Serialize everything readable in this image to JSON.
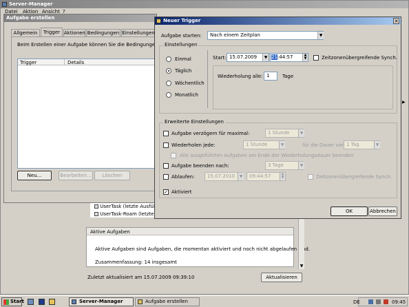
{
  "server_manager": {
    "title": "Server-Manager",
    "menu": [
      "Datei",
      "Aktion",
      "Ansicht",
      "?"
    ],
    "tree_items": [
      "UserTask (letzte Ausführ",
      "UserTask-Roam (letzte Au"
    ],
    "active_tasks_header": "Aktive Aufgaben",
    "active_tasks_desc": "Aktive Aufgaben sind Aufgaben, die momentan aktiviert und noch nicht abgelaufen sind.",
    "summary": "Zusammenfassung: 14 insgesamt",
    "last_updated": "Zuletzt aktualisiert am 15.07.2009 09:39:10",
    "refresh_button": "Aktualisieren"
  },
  "create_task": {
    "title": "Aufgabe erstellen",
    "tabs": [
      "Allgemein",
      "Trigger",
      "Aktionen",
      "Bedingungen",
      "Einstellungen"
    ],
    "active_tab": "Trigger",
    "intro": "Beim Erstellen einer Aufgabe können Sie die Bedingungen ang",
    "columns": [
      "Trigger",
      "Details"
    ],
    "buttons": {
      "new": "Neu...",
      "edit": "Bearbeiten...",
      "delete": "Löschen"
    }
  },
  "new_trigger": {
    "title": "Neuer Trigger",
    "start_task_label": "Aufgabe starten:",
    "start_task_value": "Nach einem Zeitplan",
    "settings_group": "Einstellungen",
    "schedule_options": [
      "Einmal",
      "Täglich",
      "Wöchentlich",
      "Monatlich"
    ],
    "selected_schedule": "Täglich",
    "start_label": "Start:",
    "start_date": "15.07.2009",
    "start_time_hour": "21",
    "start_time_rest": ":44:57",
    "sync_label": "Zeitzonenübergreifende Synch.",
    "repeat_label": "Wiederholung alle:",
    "repeat_value": "1",
    "repeat_unit": "Tage",
    "advanced_group": "Erweiterte Einstellungen",
    "delay_label": "Aufgabe verzögern für maximal:",
    "delay_value": "1 Stunde",
    "repeat_every_label": "Wiederholen jede:",
    "repeat_every_value": "1 Stunde",
    "duration_label": "für die Dauer von:",
    "duration_value": "1 Tag",
    "stop_all_label": "Alle ausgeführten Aufgaben am Ende der Wiederholungsdauer beenden",
    "stop_after_label": "Aufgabe beenden nach:",
    "stop_after_value": "3 Tage",
    "expire_label": "Ablaufen:",
    "expire_date": "15.07.2010",
    "expire_time": "09:44:57",
    "expire_sync_label": "Zeitzonenübergreifende Synch.",
    "enabled_label": "Aktiviert",
    "ok": "OK",
    "cancel": "Abbrechen"
  },
  "taskbar": {
    "start": "Start",
    "items": [
      "Server-Manager",
      "Aufgabe erstellen"
    ],
    "lang": "DE",
    "clock": "09:45"
  },
  "colors": {
    "titlebar_active": "#0a246a",
    "titlebar_inactive": "#808080",
    "desktop": "#3a6ea5"
  }
}
